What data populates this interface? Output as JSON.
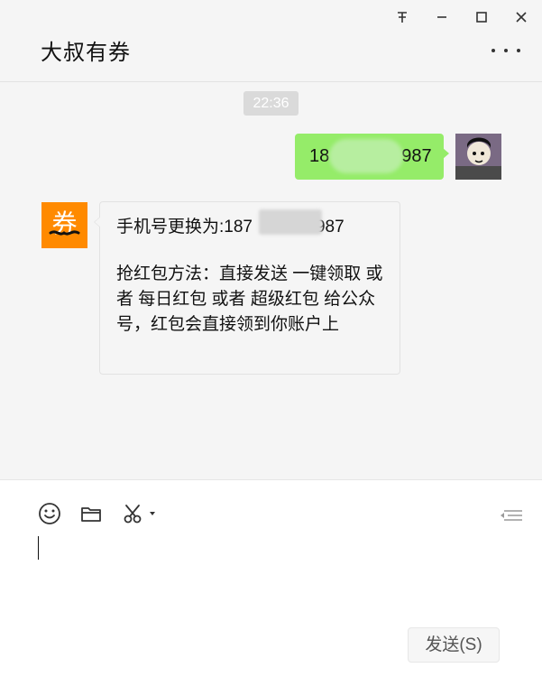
{
  "window": {
    "controls": [
      "pin",
      "minimize",
      "maximize",
      "close"
    ]
  },
  "header": {
    "title": "大叔有券",
    "more_icon": "more-dots-icon"
  },
  "chat": {
    "timestamp": "22:36",
    "outgoing": {
      "text_prefix": "18",
      "text_suffix": "987",
      "avatar": "user-avatar"
    },
    "incoming": {
      "line1_prefix": "手机号更换为:187",
      "line1_suffix": "987",
      "paragraph": "抢红包方法：直接发送 一键领取 或者 每日红包 或者 超级红包 给公众号，红包会直接领到你账户上",
      "avatar": "bot-avatar-券"
    }
  },
  "composer": {
    "toolbar": [
      "emoji-icon",
      "folder-icon",
      "scissors-icon"
    ],
    "send_label": "发送(S)"
  },
  "colors": {
    "bubble_out": "#95ec69",
    "bubble_in": "#f5f5f5",
    "panel": "#f5f5f5",
    "composer": "#ffffff",
    "bot_avatar": "#ff8a00"
  }
}
